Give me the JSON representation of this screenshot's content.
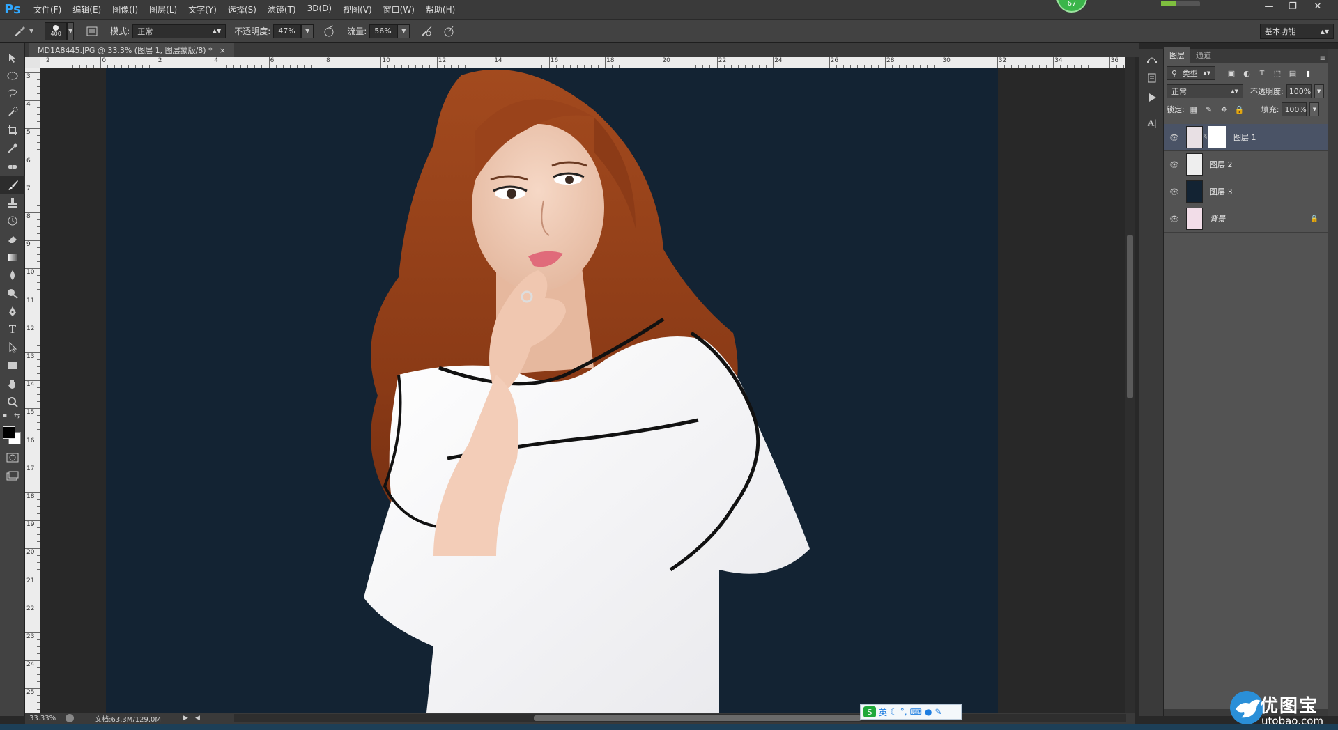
{
  "app": {
    "logo": "Ps",
    "badge": "67"
  },
  "menu": [
    "文件(F)",
    "编辑(E)",
    "图像(I)",
    "图层(L)",
    "文字(Y)",
    "选择(S)",
    "滤镜(T)",
    "3D(D)",
    "视图(V)",
    "窗口(W)",
    "帮助(H)"
  ],
  "window_controls": {
    "minimize": "—",
    "restore": "❐",
    "close": "✕"
  },
  "options": {
    "brush_size": "400",
    "mode_label": "模式:",
    "mode_value": "正常",
    "opacity_label": "不透明度:",
    "opacity_value": "47%",
    "flow_label": "流量:",
    "flow_value": "56%",
    "workspace": "基本功能"
  },
  "document": {
    "tab_title": "MD1A8445.JPG @ 33.3% (图层 1, 图层蒙版/8) *",
    "tab_close": "×",
    "zoom": "33.33%",
    "doc_info": "文档:63.3M/129.0M"
  },
  "ruler_h_labels": [
    "2",
    "0",
    "2",
    "4",
    "6",
    "8",
    "10",
    "12",
    "14",
    "16",
    "18",
    "20",
    "22",
    "24",
    "26",
    "28",
    "30",
    "32",
    "34",
    "36"
  ],
  "ruler_v_labels": [
    "3",
    "4",
    "5",
    "6",
    "7",
    "8",
    "9",
    "10",
    "11",
    "12",
    "13",
    "14",
    "15",
    "16",
    "17",
    "18",
    "19",
    "20",
    "21",
    "22",
    "23",
    "24",
    "25"
  ],
  "layers_panel": {
    "tabs": [
      "图层",
      "通道"
    ],
    "filter_kind": "类型",
    "blend_mode": "正常",
    "opacity_label": "不透明度:",
    "opacity_value": "100%",
    "lock_label": "锁定:",
    "fill_label": "填充:",
    "fill_value": "100%",
    "layers": [
      {
        "name": "图层 1",
        "selected": true,
        "has_mask": true,
        "locked": false
      },
      {
        "name": "图层 2",
        "selected": false,
        "has_mask": false,
        "locked": false
      },
      {
        "name": "图层 3",
        "selected": false,
        "has_mask": false,
        "locked": false
      },
      {
        "name": "背景",
        "selected": false,
        "has_mask": false,
        "locked": true
      }
    ]
  },
  "ime": {
    "logo": "S",
    "mode": "英"
  },
  "watermark": {
    "title": "优图宝",
    "url": "utobao.com"
  },
  "colors": {
    "canvas_bg": "#132333",
    "selected_layer": "#4a5366",
    "brand_blue": "#31a8ff"
  }
}
